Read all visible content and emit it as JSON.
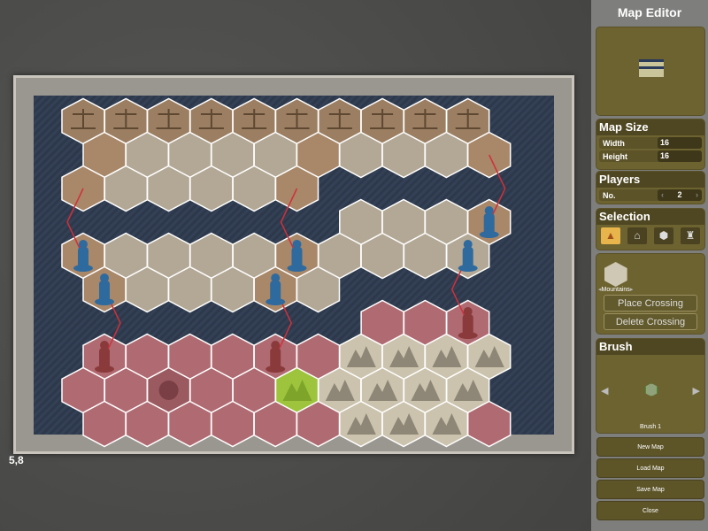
{
  "status": {
    "coordinates": "5,8"
  },
  "panel": {
    "title": "Map Editor",
    "map_size": {
      "header": "Map Size",
      "width_label": "Width",
      "width": "16",
      "height_label": "Height",
      "height": "16"
    },
    "players": {
      "header": "Players",
      "no_label": "No.",
      "count": "2"
    },
    "selection": {
      "header": "Selection",
      "icons": [
        "terrain-icon",
        "building-icon",
        "hex-icon",
        "unit-icon"
      ],
      "active": 0
    },
    "terrain": {
      "name": "Mountains",
      "place_crossing": "Place Crossing",
      "delete_crossing": "Delete Crossing"
    },
    "brush": {
      "header": "Brush",
      "name": "Brush 1"
    },
    "buttons": {
      "new_map": "New Map",
      "load_map": "Load Map",
      "save_map": "Save Map",
      "close": "Close"
    }
  },
  "map": {
    "legend": {
      "T": "temple",
      "b": "dirt",
      "s": "stone",
      "p": "red-plains",
      "m": "mountains",
      "g": "selected-mountains",
      "r": "rubble",
      ".": "water"
    },
    "colors": {
      "T": "#9c7f62",
      "b": "#a98769",
      "s": "#b3a895",
      "p": "#b06a72",
      "m": "#cbc3ad",
      "g": "#9dc43c",
      "r": "#9a5a60",
      "water": "#2f3b4e",
      "crossing": "#d0303a",
      "blue_team": "#2f6a9e",
      "red_team": "#8a3a3a"
    },
    "rows": [
      "TTTTTTTTTT",
      "bssssbsssb",
      "bssssb....",
      "......sssb",
      "bssssbssss",
      "bsssbs....",
      ".......ppp",
      "ppppppmmmm",
      "pprppgmmmm",
      "ppppppmmmp"
    ],
    "units": [
      {
        "row": 3,
        "col": 9,
        "team": "blue"
      },
      {
        "row": 4,
        "col": 0,
        "team": "blue"
      },
      {
        "row": 4,
        "col": 5,
        "team": "blue"
      },
      {
        "row": 4,
        "col": 9,
        "team": "blue"
      },
      {
        "row": 5,
        "col": 0,
        "team": "blue"
      },
      {
        "row": 5,
        "col": 4,
        "team": "blue"
      },
      {
        "row": 6,
        "col": 9,
        "team": "red"
      },
      {
        "row": 7,
        "col": 0,
        "team": "red"
      },
      {
        "row": 7,
        "col": 4,
        "team": "red"
      }
    ],
    "crossings": [
      [
        [
          2,
          0
        ],
        [
          4,
          0
        ]
      ],
      [
        [
          5,
          0
        ],
        [
          7,
          0
        ]
      ],
      [
        [
          2,
          5
        ],
        [
          4,
          5
        ]
      ],
      [
        [
          5,
          4
        ],
        [
          7,
          4
        ]
      ],
      [
        [
          1,
          9
        ],
        [
          3,
          9
        ]
      ],
      [
        [
          4,
          9
        ],
        [
          6,
          9
        ]
      ]
    ]
  }
}
